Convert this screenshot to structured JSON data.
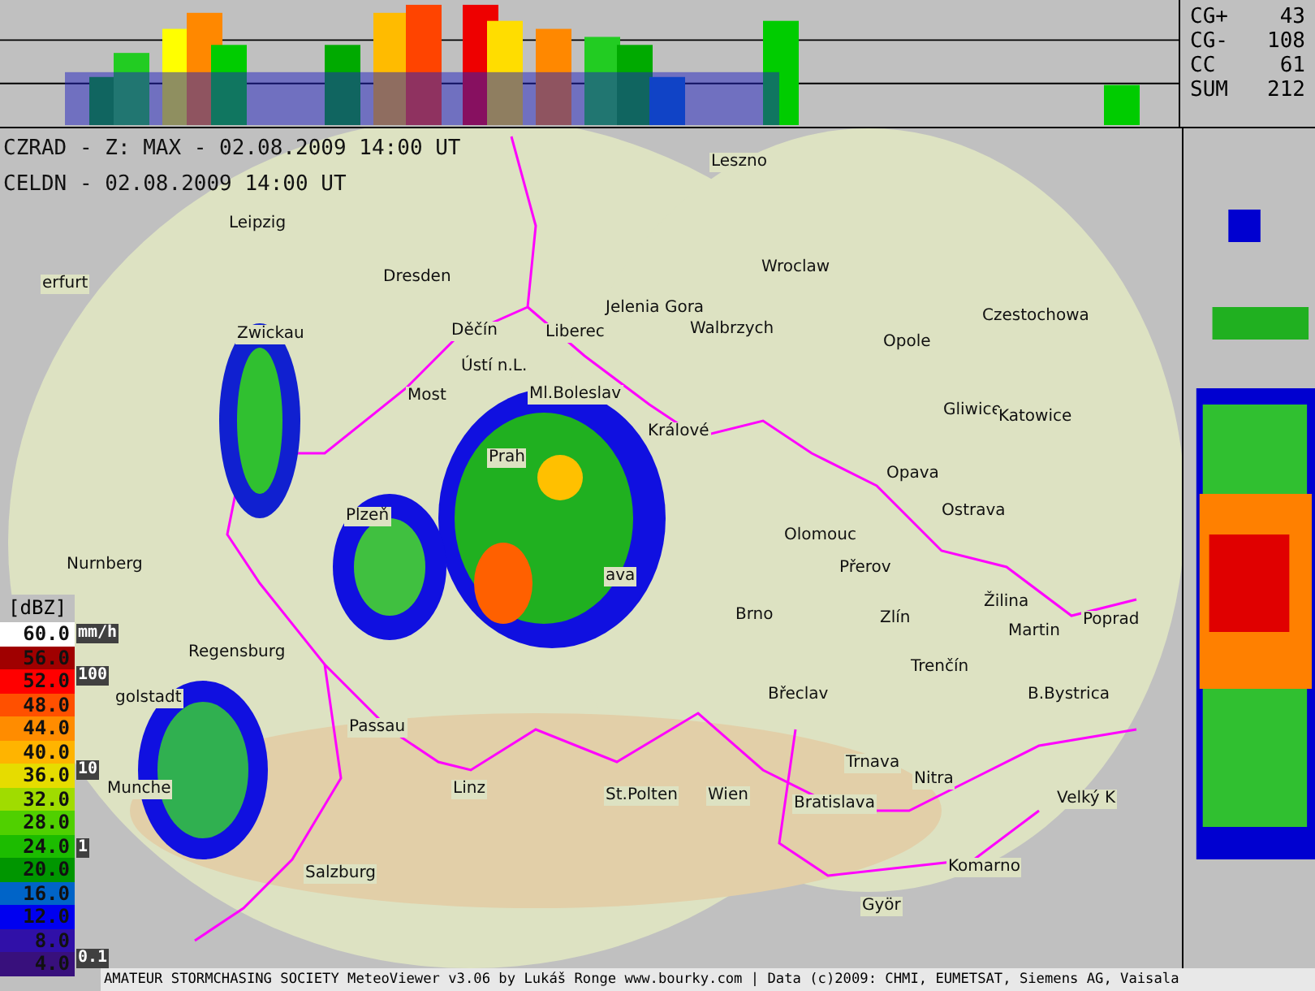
{
  "stats": [
    {
      "label": "CG+",
      "value": "43"
    },
    {
      "label": "CG-",
      "value": "108"
    },
    {
      "label": "CC",
      "value": "61"
    },
    {
      "label": "SUM",
      "value": "212"
    }
  ],
  "header": {
    "radar": "CZRAD - Z: MAX - 02.08.2009 14:00 UT",
    "lightning": "CELDN - 02.08.2009 14:00 UT"
  },
  "cities": [
    "Leszno",
    "Leipzig",
    "Dresden",
    "Wroclaw",
    "erfurt",
    "Zwickau",
    "Děčín",
    "Liberec",
    "Jelenia Gora",
    "Walbrzych",
    "Opole",
    "Czestochowa",
    "Ústí n.L.",
    "Most",
    "Ml.Boleslav",
    "Gliwice",
    "Katowice",
    "Králové",
    "Prah",
    "Opava",
    "Ostrava",
    "Plzeň",
    "Olomouc",
    "Přerov",
    "Nurnberg",
    "ava",
    "Brno",
    "Zlín",
    "Žilina",
    "Martin",
    "Poprad",
    "Regensburg",
    "Trenčín",
    "golstadt",
    "Břeclav",
    "B.Bystrica",
    "Passau",
    "Trnava",
    "Nitra",
    "Munche",
    "Linz",
    "St.Polten",
    "Wien",
    "Bratislava",
    "Velký K",
    "Salzburg",
    "Komarno",
    "Györ"
  ],
  "legend": {
    "unit": "[dBZ]",
    "rain_unit": "mm/h",
    "rain_marks": [
      "100",
      "10",
      "1",
      "0.1"
    ],
    "steps": [
      {
        "value": "60.0",
        "color": "#ffffff"
      },
      {
        "value": "56.0",
        "color": "#a00000"
      },
      {
        "value": "52.0",
        "color": "#ff0000"
      },
      {
        "value": "48.0",
        "color": "#ff5000"
      },
      {
        "value": "44.0",
        "color": "#ff8c00"
      },
      {
        "value": "40.0",
        "color": "#ffb400"
      },
      {
        "value": "36.0",
        "color": "#e6dc00"
      },
      {
        "value": "32.0",
        "color": "#a0dc00"
      },
      {
        "value": "28.0",
        "color": "#50d000"
      },
      {
        "value": "24.0",
        "color": "#1cbc00"
      },
      {
        "value": "20.0",
        "color": "#009600"
      },
      {
        "value": "16.0",
        "color": "#0064c8"
      },
      {
        "value": "12.0",
        "color": "#0000f0"
      },
      {
        "value": "8.0",
        "color": "#3010a8"
      },
      {
        "value": "4.0",
        "color": "#38107c"
      }
    ]
  },
  "footer": "AMATEUR STORMCHASING SOCIETY MeteoViewer v3.06 by Lukáš Ronge www.bourky.com | Data (c)2009: CHMI, EUMETSAT, Siemens AG, Vaisala"
}
